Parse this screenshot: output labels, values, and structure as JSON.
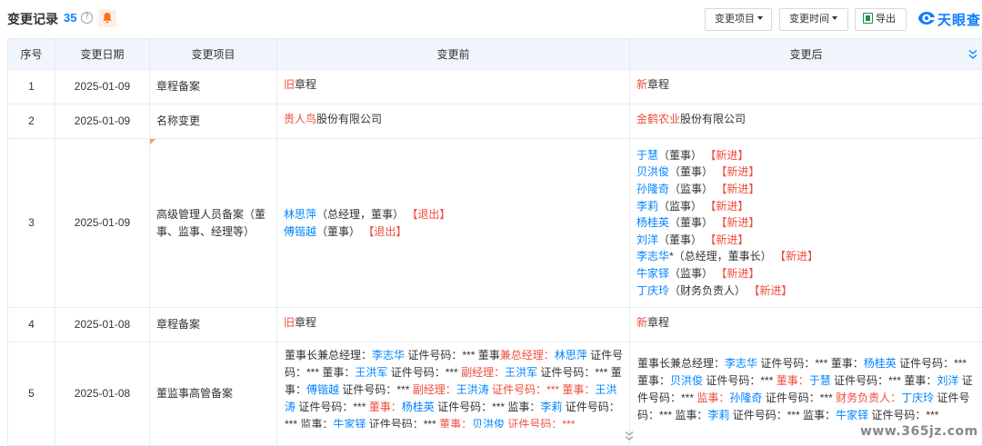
{
  "header": {
    "title": "变更记录",
    "count": "35",
    "help_glyph": "?",
    "buttons": {
      "item_filter": "变更项目",
      "time_filter": "变更时间",
      "export": "导出"
    },
    "logo_text": "天眼查"
  },
  "columns": {
    "index": "序号",
    "date": "变更日期",
    "item": "变更项目",
    "before": "变更前",
    "after": "变更后"
  },
  "rows": [
    {
      "index": "1",
      "date": "2025-01-09",
      "item": "章程备案",
      "before": [
        {
          "hl": "旧",
          "text": "章程"
        }
      ],
      "after": [
        {
          "hl": "新",
          "text": "章程"
        }
      ]
    },
    {
      "index": "2",
      "date": "2025-01-09",
      "item": "名称变更",
      "before": [
        {
          "hl": "贵人鸟",
          "text": "股份有限公司"
        }
      ],
      "after": [
        {
          "hl": "金鹤农业",
          "text": "股份有限公司"
        }
      ]
    },
    {
      "index": "3",
      "date": "2025-01-09",
      "item": "高级管理人员备案（董事、监事、经理等）",
      "before": [
        {
          "name": "林思萍",
          "role": "（总经理，董事）",
          "tag": "【退出】"
        },
        {
          "name": "傅锴越",
          "role": "（董事）",
          "tag": "【退出】"
        }
      ],
      "after": [
        {
          "name": "于慧",
          "role": "（董事）",
          "tag": "【新进】"
        },
        {
          "name": "贝洪俊",
          "role": "（董事）",
          "tag": "【新进】"
        },
        {
          "name": "孙隆奇",
          "role": "（监事）",
          "tag": "【新进】"
        },
        {
          "name": "李莉",
          "role": "（监事）",
          "tag": "【新进】"
        },
        {
          "name": "杨桂英",
          "role": "（董事）",
          "tag": "【新进】"
        },
        {
          "name": "刘洋",
          "role": "（董事）",
          "tag": "【新进】"
        },
        {
          "name": "李志华",
          "role": "*（总经理，董事长）",
          "tag": "【新进】"
        },
        {
          "name": "牛家铎",
          "role": "（监事）",
          "tag": "【新进】"
        },
        {
          "name": "丁庆玲",
          "role": "（财务负责人）",
          "tag": "【新进】"
        }
      ]
    },
    {
      "index": "4",
      "date": "2025-01-08",
      "item": "章程备案",
      "before": [
        {
          "hl": "旧",
          "text": "章程"
        }
      ],
      "after": [
        {
          "hl": "新",
          "text": "章程"
        }
      ]
    },
    {
      "index": "5",
      "date": "2025-01-08",
      "item": "董监事高管备案",
      "before_segments": [
        {
          "t": "董事长兼总经理：",
          "c": "n"
        },
        {
          "t": "李志华",
          "c": "b"
        },
        {
          "t": " 证件号码：*** 董事",
          "c": "n"
        },
        {
          "t": "兼总经理：",
          "c": "r"
        },
        {
          "t": "林思萍",
          "c": "b"
        },
        {
          "t": " 证件号码：*** 董事：",
          "c": "n"
        },
        {
          "t": "王洪军",
          "c": "b"
        },
        {
          "t": " 证件号码：*** ",
          "c": "n"
        },
        {
          "t": "副经理：",
          "c": "r"
        },
        {
          "t": "王洪军",
          "c": "b"
        },
        {
          "t": " 证件号码：*** 董事：",
          "c": "n"
        },
        {
          "t": "傅锴越",
          "c": "b"
        },
        {
          "t": " 证件号码：*** ",
          "c": "n"
        },
        {
          "t": "副经理：",
          "c": "r"
        },
        {
          "t": "王洪涛",
          "c": "b"
        },
        {
          "t": " 证件号码：*** 董事：",
          "c": "r"
        },
        {
          "t": "王洪涛",
          "c": "b"
        },
        {
          "t": " 证件号码：*** ",
          "c": "n"
        },
        {
          "t": "董事：",
          "c": "r"
        },
        {
          "t": "杨桂英",
          "c": "b"
        },
        {
          "t": " 证件号码：*** 监事：",
          "c": "n"
        },
        {
          "t": "李莉",
          "c": "b"
        },
        {
          "t": " 证件号码：*** 监事：",
          "c": "n"
        },
        {
          "t": "牛家铎",
          "c": "b"
        },
        {
          "t": " 证件号码：*** ",
          "c": "n"
        },
        {
          "t": "董事：",
          "c": "r"
        },
        {
          "t": "贝洪俊",
          "c": "b"
        },
        {
          "t": " 证件号码：***",
          "c": "r"
        }
      ],
      "after_segments": [
        {
          "t": "董事长兼总经理：",
          "c": "n"
        },
        {
          "t": "李志华",
          "c": "b"
        },
        {
          "t": " 证件号码：*** 董事：",
          "c": "n"
        },
        {
          "t": "杨桂英",
          "c": "b"
        },
        {
          "t": " 证件号码：*** 董事：",
          "c": "n"
        },
        {
          "t": "贝洪俊",
          "c": "b"
        },
        {
          "t": " 证件号码：*** ",
          "c": "n"
        },
        {
          "t": "董事：",
          "c": "r"
        },
        {
          "t": "于慧",
          "c": "b"
        },
        {
          "t": " 证件号码：*** 董事：",
          "c": "n"
        },
        {
          "t": "刘洋",
          "c": "b"
        },
        {
          "t": " 证件号码：*** ",
          "c": "n"
        },
        {
          "t": "监事：",
          "c": "r"
        },
        {
          "t": "孙隆奇",
          "c": "b"
        },
        {
          "t": " 证件号码：*** ",
          "c": "n"
        },
        {
          "t": "财务负责人：",
          "c": "r"
        },
        {
          "t": "丁庆玲",
          "c": "b"
        },
        {
          "t": " 证件号码：*** 监事：",
          "c": "n"
        },
        {
          "t": "李莉",
          "c": "b"
        },
        {
          "t": " 证件号码：*** 监事：",
          "c": "n"
        },
        {
          "t": "牛家铎",
          "c": "b"
        },
        {
          "t": " 证件号码：***",
          "c": "n"
        }
      ]
    }
  ],
  "watermark": "www.365jz.com",
  "colors": {
    "accent": "#0084ff",
    "highlight": "#f04c3e",
    "header_bg": "#f1f6fd"
  }
}
